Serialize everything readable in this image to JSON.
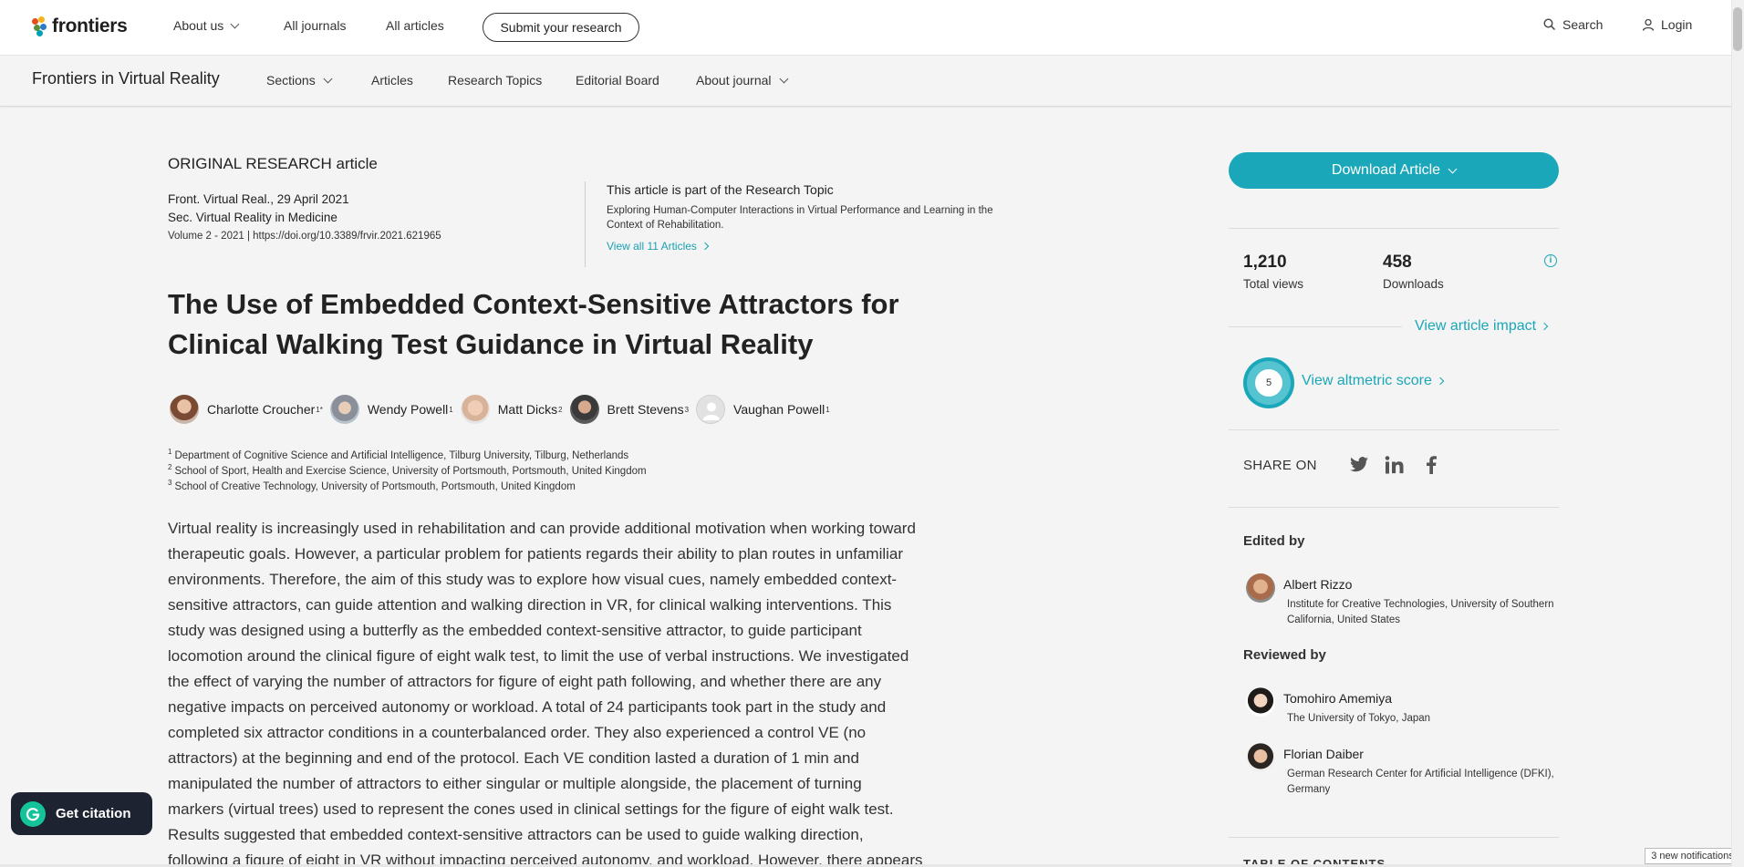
{
  "topnav": {
    "logo_text": "frontiers",
    "items": [
      {
        "label": "About us",
        "has_dropdown": true
      },
      {
        "label": "All journals"
      },
      {
        "label": "All articles"
      }
    ],
    "submit_button": "Submit your research",
    "search_label": "Search",
    "login_label": "Login"
  },
  "journalnav": {
    "journal_name": "Frontiers in Virtual Reality",
    "items": [
      {
        "label": "Sections",
        "has_dropdown": true
      },
      {
        "label": "Articles"
      },
      {
        "label": "Research Topics"
      },
      {
        "label": "Editorial Board"
      },
      {
        "label": "About journal",
        "has_dropdown": true
      }
    ]
  },
  "article": {
    "type": "ORIGINAL RESEARCH article",
    "journal_date": "Front. Virtual Real., 29 April 2021",
    "section": "Sec. Virtual Reality in Medicine",
    "volume_doi": "Volume 2 - 2021 | https://doi.org/10.3389/frvir.2021.621965",
    "research_topic": {
      "heading": "This article is part of the Research Topic",
      "title": "Exploring Human-Computer Interactions in Virtual Performance and Learning in the Context of Rehabilitation.",
      "link": "View all 11 Articles"
    },
    "title": "The Use of Embedded Context-Sensitive Attractors for Clinical Walking Test Guidance in Virtual Reality",
    "authors": [
      {
        "name": "Charlotte Croucher",
        "sup": "1*"
      },
      {
        "name": "Wendy Powell",
        "sup": "1"
      },
      {
        "name": "Matt Dicks",
        "sup": "2"
      },
      {
        "name": "Brett Stevens",
        "sup": "3"
      },
      {
        "name": "Vaughan Powell",
        "sup": "1"
      }
    ],
    "affiliations": [
      {
        "num": "1",
        "text": "Department of Cognitive Science and Artificial Intelligence, Tilburg University, Tilburg, Netherlands"
      },
      {
        "num": "2",
        "text": "School of Sport, Health and Exercise Science, University of Portsmouth, Portsmouth, United Kingdom"
      },
      {
        "num": "3",
        "text": "School of Creative Technology, University of Portsmouth, Portsmouth, United Kingdom"
      }
    ],
    "abstract_lines": [
      "Virtual reality is increasingly used in rehabilitation and can provide additional motivation when working toward",
      "therapeutic goals. However, a particular problem for patients regards their ability to plan routes in unfamiliar",
      "environments. Therefore, the aim of this study was to explore how visual cues, namely embedded context-",
      "sensitive attractors, can guide attention and walking direction in VR, for clinical walking interventions. This",
      "study was designed using a butterfly as the embedded context-sensitive attractor, to guide participant",
      "locomotion around the clinical figure of eight walk test, to limit the use of verbal instructions. We investigated",
      "the effect of varying the number of attractors for figure of eight path following, and whether there are any",
      "negative impacts on perceived autonomy or workload. A total of 24 participants took part in the study and",
      "completed six attractor conditions in a counterbalanced order. They also experienced a control VE (no",
      "attractors) at the beginning and end of the protocol. Each VE condition lasted a duration of 1 min and",
      "manipulated the number of attractors to either singular or multiple alongside, the placement of turning",
      "markers (virtual trees) used to represent the cones used in clinical settings for the figure of eight walk test.",
      "Results suggested that embedded context-sensitive attractors can be used to guide walking direction,",
      "following a figure of eight in VR without impacting perceived autonomy, and workload. However, there appears"
    ]
  },
  "sidebar": {
    "download_button": "Download Article",
    "views_count": "1,210",
    "views_label": "Total views",
    "downloads_count": "458",
    "downloads_label": "Downloads",
    "impact_link": "View article impact",
    "altmetric_score": "5",
    "altmetric_link": "View altmetric score",
    "share_label": "SHARE ON",
    "edited_by": "Edited by",
    "editor": {
      "name": "Albert Rizzo",
      "affiliation": "Institute for Creative Technologies, University of Southern California, United States"
    },
    "reviewed_by": "Reviewed by",
    "reviewers": [
      {
        "name": "Tomohiro Amemiya",
        "affiliation": "The University of Tokyo, Japan"
      },
      {
        "name": "Florian Daiber",
        "affiliation": "German Research Center for Artificial Intelligence (DFKI), Germany"
      }
    ],
    "toc_heading": "TABLE OF CONTENTS"
  },
  "floating": {
    "citation_button": "Get citation",
    "notifications": "3 new notifications"
  },
  "colors": {
    "accent": "#1aa7b9",
    "citation_bg": "#1e2331",
    "grammarly_green": "#15c39a"
  }
}
